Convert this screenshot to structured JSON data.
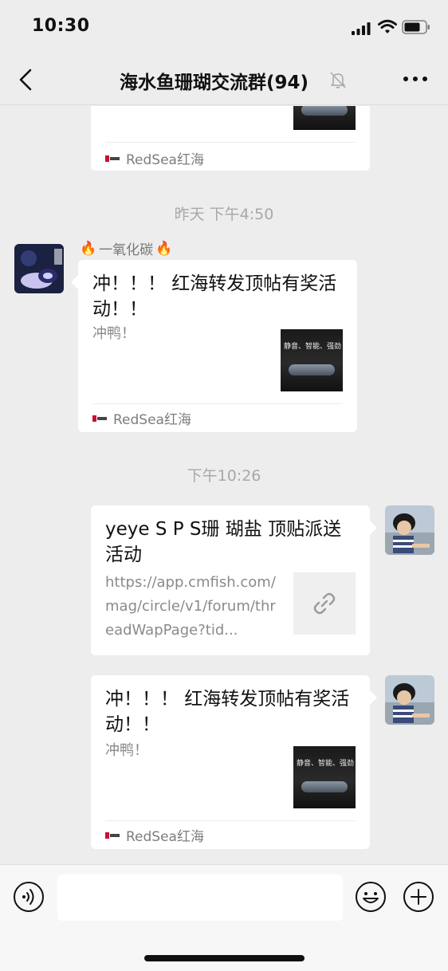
{
  "status_bar": {
    "time": "10:30"
  },
  "nav": {
    "title": "海水鱼珊瑚交流群(94)"
  },
  "messages": {
    "top_card": {
      "source": "RedSea红海"
    },
    "ts1": "昨天 下午4:50",
    "msg1": {
      "sender": "一氧化碳",
      "title": "冲！！！ 红海转发顶帖有奖活动！！",
      "desc": "冲鸭！",
      "thumb_text": "静音、智能、强劲",
      "source": "RedSea红海"
    },
    "ts2": "下午10:26",
    "msg2": {
      "title": "yeye S P S珊 瑚盐 顶贴派送活动",
      "desc": "https://app.cmfish.com/mag/circle/v1/forum/threadWapPage?tid..."
    },
    "msg3": {
      "title": "冲！！！ 红海转发顶帖有奖活动！！",
      "desc": "冲鸭！",
      "thumb_text": "静音、智能、强劲",
      "source": "RedSea红海"
    }
  },
  "input_bar": {
    "placeholder": ""
  },
  "colors": {
    "background": "#ededed",
    "bubble": "#ffffff",
    "timestamp": "#a8a8a8"
  }
}
